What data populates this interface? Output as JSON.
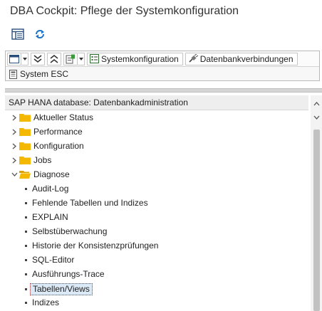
{
  "window": {
    "title": "DBA Cockpit: Pflege der Systemkonfiguration"
  },
  "app_toolbar": {
    "icons": [
      "layout-icon",
      "refresh-icon"
    ]
  },
  "toolbar": {
    "system_config_label": "Systemkonfiguration",
    "db_connections_label": "Datenbankverbindungen"
  },
  "system_row": {
    "label": "System ESC"
  },
  "tree": {
    "header": "SAP HANA database: Datenbankadministration",
    "folders": [
      {
        "label": "Aktueller Status",
        "expanded": false
      },
      {
        "label": "Performance",
        "expanded": false
      },
      {
        "label": "Konfiguration",
        "expanded": false
      },
      {
        "label": "Jobs",
        "expanded": false
      },
      {
        "label": "Diagnose",
        "expanded": true
      }
    ],
    "leaves": [
      {
        "label": "Audit-Log"
      },
      {
        "label": "Fehlende Tabellen und Indizes"
      },
      {
        "label": "EXPLAIN"
      },
      {
        "label": "Selbstüberwachung"
      },
      {
        "label": "Historie der Konsistenzprüfungen"
      },
      {
        "label": "SQL-Editor"
      },
      {
        "label": "Ausführungs-Trace"
      },
      {
        "label": "Tabellen/Views",
        "selected": true
      },
      {
        "label": "Indizes"
      }
    ]
  },
  "colors": {
    "folder": "#f5b800",
    "selection_bg": "#dce9f7",
    "selection_border": "#cc2222"
  }
}
